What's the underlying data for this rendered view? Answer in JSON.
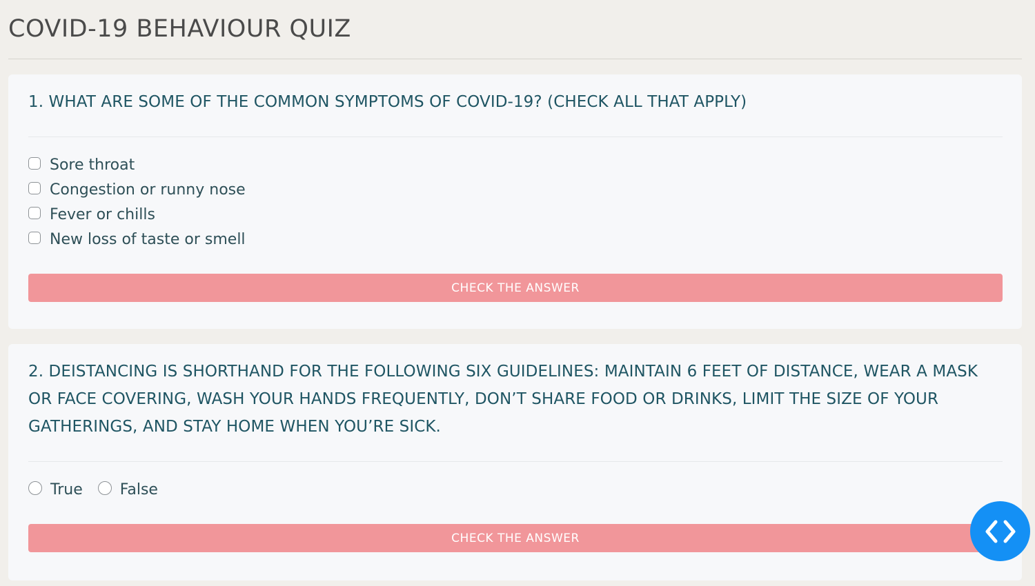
{
  "page": {
    "title": "COVID-19 BEHAVIOUR QUIZ"
  },
  "questions": [
    {
      "text": "1. What are some of the common symptoms of COVID-19? (Check all that apply)",
      "input_type": "checkbox",
      "options": [
        {
          "label": "Sore throat",
          "checked": false
        },
        {
          "label": "Congestion or runny nose",
          "checked": false
        },
        {
          "label": "Fever or chills",
          "checked": false
        },
        {
          "label": "New loss of taste or smell",
          "checked": false
        }
      ],
      "button_label": "CHECK THE ANSWER"
    },
    {
      "text": "2. DEISTANCING is shorthand for the following six guidelines: Maintain 6 feet of distance, Wear a mask or face covering, Wash your hands frequently, Don’t share food or drinks, Limit the size of your gatherings, and Stay home when you’re sick.",
      "input_type": "radio",
      "options": [
        {
          "label": "True",
          "checked": false
        },
        {
          "label": "False",
          "checked": false
        }
      ],
      "button_label": "CHECK THE ANSWER"
    }
  ],
  "nav_fab": {
    "icon": "code-brackets-icon",
    "color": "#1490f5"
  },
  "colors": {
    "button": "#f1969a",
    "question_text": "#1f5563",
    "background": "#f1efeb",
    "card": "#f7f8fa"
  }
}
